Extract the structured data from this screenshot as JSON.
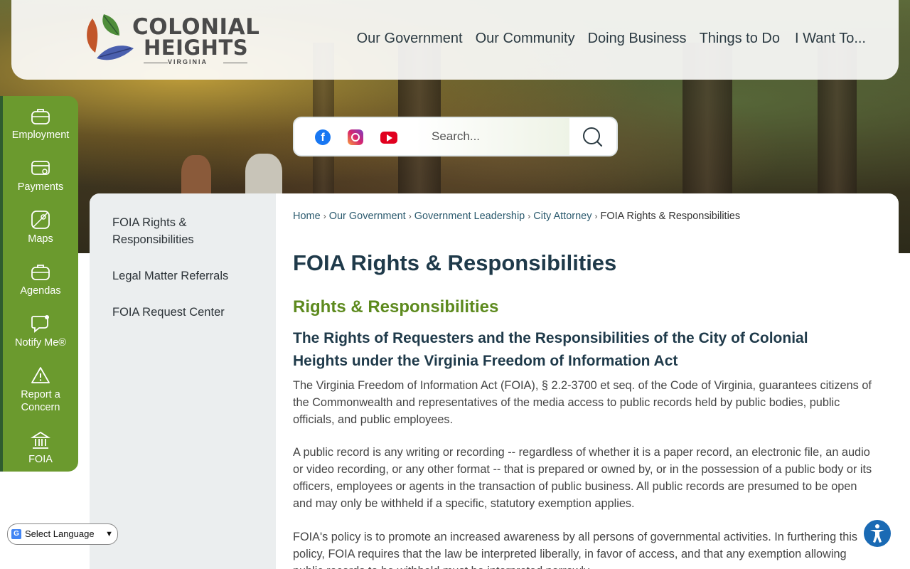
{
  "header": {
    "logo": {
      "line1": "COLONIAL",
      "line2": "HEIGHTS",
      "line3": "VIRGINIA"
    },
    "nav": [
      "Our Government",
      "Our Community",
      "Doing Business",
      "Things to Do",
      "I Want To..."
    ]
  },
  "social": {
    "icons": [
      "facebook-icon",
      "instagram-icon",
      "youtube-icon"
    ]
  },
  "search": {
    "placeholder": "Search..."
  },
  "quick_links": [
    {
      "label": "Employment",
      "icon": "briefcase-icon"
    },
    {
      "label": "Payments",
      "icon": "card-icon"
    },
    {
      "label": "Maps",
      "icon": "map-icon"
    },
    {
      "label": "Agendas",
      "icon": "briefcase-icon"
    },
    {
      "label": "Notify Me®",
      "icon": "chat-icon"
    },
    {
      "label": "Report a Concern",
      "icon": "warning-icon"
    },
    {
      "label": "FOIA",
      "icon": "building-icon"
    }
  ],
  "sidenav": [
    "FOIA Rights & Responsibilities",
    "Legal Matter Referrals",
    "FOIA Request Center"
  ],
  "breadcrumb": [
    "Home",
    "Our Government",
    "Government Leadership",
    "City Attorney",
    "FOIA Rights & Responsibilities"
  ],
  "page_title": "FOIA Rights & Responsibilities",
  "section_title": "Rights & Responsibilities",
  "sub_title": "The Rights of Requesters and the Responsibilities of the City of Colonial Heights under the Virginia Freedom of Information Act",
  "paragraphs": [
    "The Virginia Freedom of Information Act (FOIA), § 2.2-3700 et seq. of the Code of Virginia, guarantees citizens of the Commonwealth and representatives of the media access to public records held by public bodies, public officials, and public employees.",
    "A public record is any writing or recording -- regardless of whether it is a paper record, an electronic file, an audio or video recording, or any other format -- that is prepared or owned by, or in the possession of a public body or its officers, employees or agents in the transaction of public business.  All public records are presumed to be open and may only be withheld if a specific, statutory exemption applies.",
    "FOIA's policy is to promote an increased awareness by all persons of governmental activities.  In furthering this policy, FOIA requires that the law be interpreted liberally, in favor of access, and that any exemption allowing public records to be withheld must be interpreted narrowly."
  ],
  "language_select": {
    "label": "Select Language"
  },
  "colors": {
    "nav_text": "#2b3a42",
    "quick_bar": "#6b9a2e",
    "section_green": "#5d8a1e",
    "title_navy": "#1f3a4a",
    "sidenav_bg": "#ebeeef"
  }
}
